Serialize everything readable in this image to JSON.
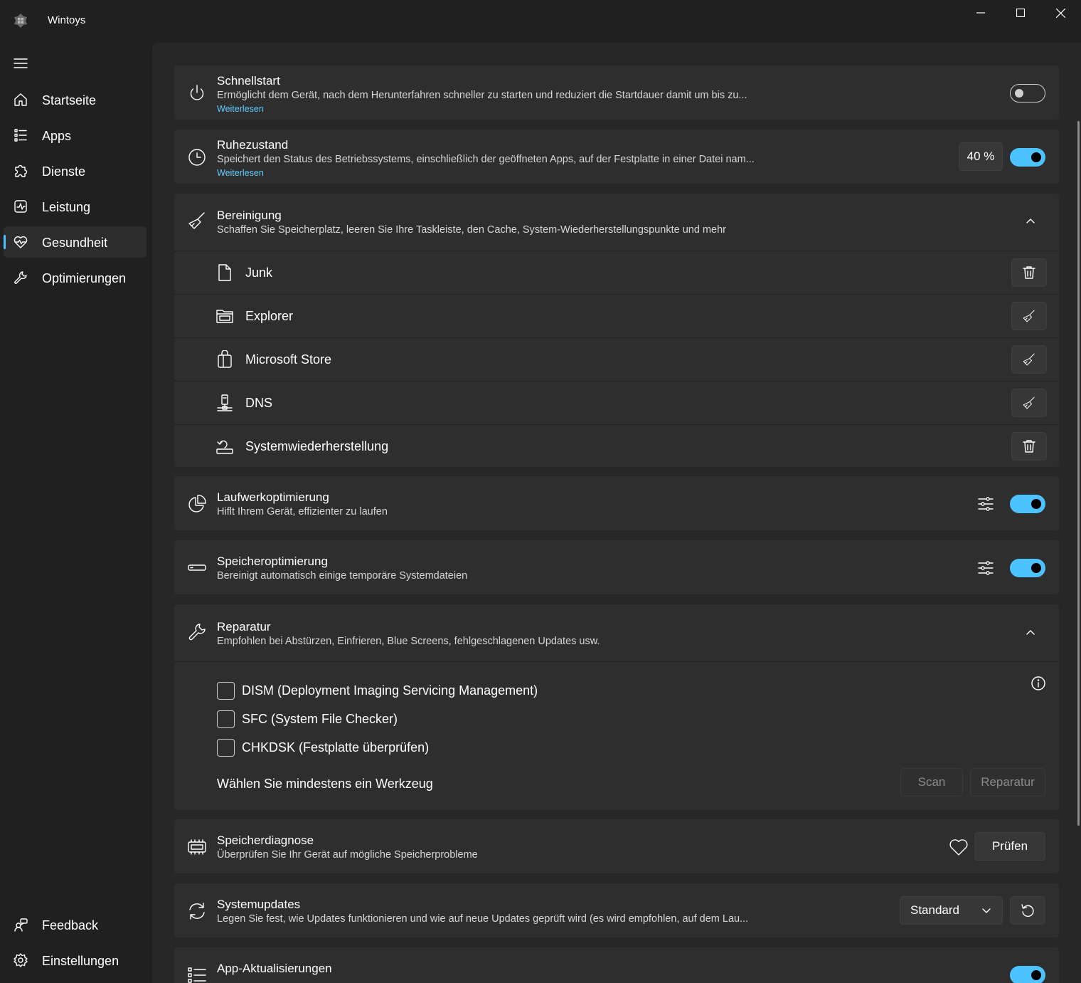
{
  "app": {
    "title": "Wintoys"
  },
  "sidebar": {
    "items": [
      {
        "label": "Startseite",
        "icon": "home-icon"
      },
      {
        "label": "Apps",
        "icon": "apps-list-icon"
      },
      {
        "label": "Dienste",
        "icon": "puzzle-icon"
      },
      {
        "label": "Leistung",
        "icon": "performance-icon"
      },
      {
        "label": "Gesundheit",
        "icon": "heart-pulse-icon",
        "active": true
      },
      {
        "label": "Optimierungen",
        "icon": "wrench-icon"
      }
    ],
    "footer": [
      {
        "label": "Feedback",
        "icon": "feedback-icon"
      },
      {
        "label": "Einstellungen",
        "icon": "gear-icon"
      }
    ]
  },
  "cards": {
    "schnellstart": {
      "title": "Schnellstart",
      "desc": "Ermöglicht dem Gerät, nach dem Herunterfahren schneller zu starten und reduziert die Startdauer damit um bis zu...",
      "link": "Weiterlesen",
      "enabled": false
    },
    "ruhezustand": {
      "title": "Ruhezustand",
      "desc": "Speichert den Status des Betriebssystems, einschließlich der geöffneten Apps, auf der Festplatte in einer Datei nam...",
      "link": "Weiterlesen",
      "percent": "40 %",
      "enabled": true
    },
    "bereinigung": {
      "title": "Bereinigung",
      "desc": "Schaffen Sie Speicherplatz, leeren Sie Ihre Taskleiste, den Cache, System-Wiederherstellungspunkte und mehr",
      "items": [
        {
          "label": "Junk",
          "icon": "document-icon",
          "action": "delete-icon"
        },
        {
          "label": "Explorer",
          "icon": "folder-icon",
          "action": "broom-icon"
        },
        {
          "label": "Microsoft Store",
          "icon": "store-bag-icon",
          "action": "broom-icon"
        },
        {
          "label": "DNS",
          "icon": "network-server-icon",
          "action": "broom-icon"
        },
        {
          "label": "Systemwiederherstellung",
          "icon": "system-restore-icon",
          "action": "delete-icon"
        }
      ]
    },
    "laufwerk": {
      "title": "Laufwerkoptimierung",
      "desc": "Hiflt Ihrem Gerät, effizienter zu laufen",
      "enabled": true
    },
    "speicheropt": {
      "title": "Speicheroptimierung",
      "desc": "Bereinigt automatisch einige temporäre Systemdateien",
      "enabled": true
    },
    "reparatur": {
      "title": "Reparatur",
      "desc": "Empfohlen bei Abstürzen, Einfrieren, Blue Screens, fehlgeschlagenen Updates usw.",
      "tools": [
        "DISM (Deployment Imaging Servicing Management)",
        "SFC (System File Checker)",
        "CHKDSK (Festplatte überprüfen)"
      ],
      "hint": "Wählen Sie mindestens ein Werkzeug",
      "scan_label": "Scan",
      "repair_label": "Reparatur"
    },
    "speicherdiag": {
      "title": "Speicherdiagnose",
      "desc": "Überprüfen Sie Ihr Gerät auf mögliche Speicherprobleme",
      "button": "Prüfen"
    },
    "systemupdates": {
      "title": "Systemupdates",
      "desc": "Legen Sie fest, wie Updates funktionieren und wie auf neue Updates geprüft wird (es wird empfohlen, auf dem Lau...",
      "selected": "Standard"
    },
    "appupdates": {
      "title": "App-Aktualisierungen",
      "enabled": true
    }
  },
  "colors": {
    "accent": "#4cc2ff",
    "link": "#60cdff",
    "background": "#202020",
    "card": "#2e2e2e"
  }
}
